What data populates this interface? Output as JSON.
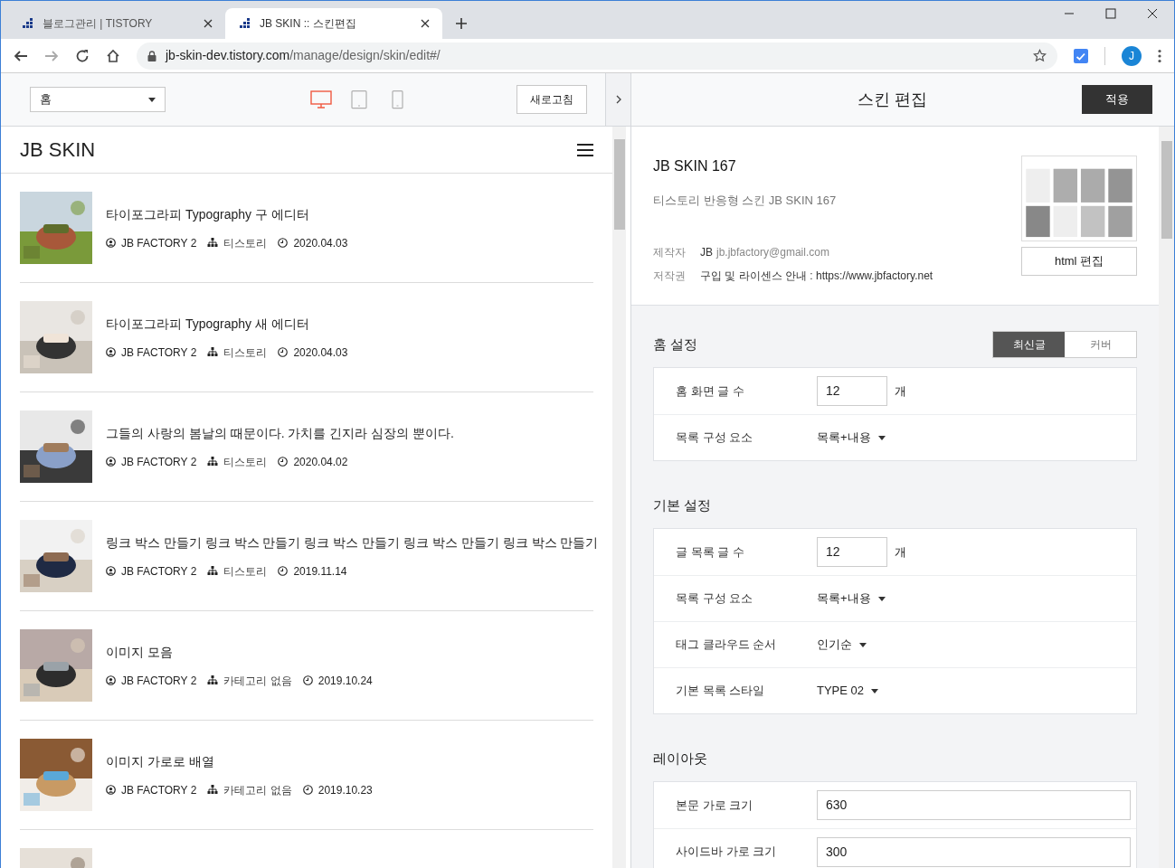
{
  "browser": {
    "tabs": [
      {
        "title": "블로그관리 | TISTORY",
        "selected": false
      },
      {
        "title": "JB SKIN :: 스킨편집",
        "selected": true
      }
    ],
    "address": {
      "host": "jb-skin-dev.tistory.com",
      "path": "/manage/design/skin/edit#/"
    },
    "profile_initial": "J"
  },
  "toolbar": {
    "page_select": "홈",
    "devices": [
      {
        "kind": "desktop",
        "selected": true
      },
      {
        "kind": "tablet",
        "selected": false
      },
      {
        "kind": "mobile",
        "selected": false
      }
    ],
    "refresh": "새로고침"
  },
  "preview": {
    "blog_title": "JB SKIN",
    "posts": [
      {
        "title": "타이포그라피 Typography 구 에디터",
        "author": "JB FACTORY 2",
        "category": "티스토리",
        "date": "2020.04.03"
      },
      {
        "title": "타이포그라피 Typography 새 에디터",
        "author": "JB FACTORY 2",
        "category": "티스토리",
        "date": "2020.04.03"
      },
      {
        "title": "그들의 사랑의 봄날의 때문이다. 가치를 긴지라 심장의 뿐이다.",
        "author": "JB FACTORY 2",
        "category": "티스토리",
        "date": "2020.04.02"
      },
      {
        "title": "링크 박스 만들기 링크 박스 만들기 링크 박스 만들기 링크 박스 만들기 링크 박스 만들기",
        "author": "JB FACTORY 2",
        "category": "티스토리",
        "date": "2019.11.14"
      },
      {
        "title": "이미지 모음",
        "author": "JB FACTORY 2",
        "category": "카테고리 없음",
        "date": "2019.10.24"
      },
      {
        "title": "이미지 가로로 배열",
        "author": "JB FACTORY 2",
        "category": "카테고리 없음",
        "date": "2019.10.23"
      }
    ]
  },
  "editor": {
    "title": "스킨 편집",
    "apply": "적용",
    "skin": {
      "name": "JB SKIN 167",
      "description": "티스토리 반응형 스킨 JB SKIN 167",
      "maker_label": "제작자",
      "maker_name": "JB",
      "maker_email": "jb.jbfactory@gmail.com",
      "copyright_label": "저작권",
      "copyright": "구입 및 라이센스 안내 : https://www.jbfactory.net",
      "html_edit": "html 편집"
    },
    "sections": [
      {
        "title": "홈 설정",
        "tabs": [
          {
            "label": "최신글",
            "selected": true
          },
          {
            "label": "커버",
            "selected": false
          }
        ],
        "rows": [
          {
            "kind": "number",
            "label": "홈 화면 글 수",
            "value": "12",
            "unit": "개"
          },
          {
            "kind": "select",
            "label": "목록 구성 요소",
            "value": "목록+내용"
          }
        ]
      },
      {
        "title": "기본 설정",
        "rows": [
          {
            "kind": "number",
            "label": "글 목록 글 수",
            "value": "12",
            "unit": "개"
          },
          {
            "kind": "select",
            "label": "목록 구성 요소",
            "value": "목록+내용"
          },
          {
            "kind": "select",
            "label": "태그 클라우드 순서",
            "value": "인기순"
          },
          {
            "kind": "select",
            "label": "기본 목록 스타일",
            "value": "TYPE 02"
          }
        ]
      },
      {
        "title": "레이아웃",
        "rows": [
          {
            "kind": "text",
            "label": "본문 가로 크기",
            "value": "630"
          },
          {
            "kind": "text",
            "label": "사이드바 가로 크기",
            "value": "300"
          }
        ]
      }
    ]
  }
}
